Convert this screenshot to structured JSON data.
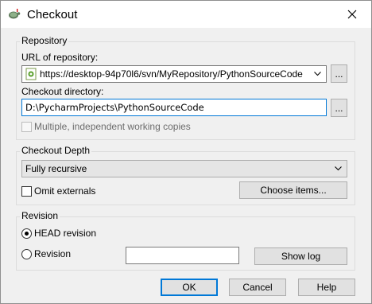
{
  "window": {
    "title": "Checkout"
  },
  "repository": {
    "legend": "Repository",
    "url_label": "URL of repository:",
    "url_value": "https://desktop-94p70l6/svn/MyRepository/PythonSourceCode",
    "url_browse": "...",
    "dir_label": "Checkout directory:",
    "dir_value": "D:\\PycharmProjects\\PythonSourceCode",
    "dir_browse": "...",
    "multiple_label": "Multiple, independent working copies"
  },
  "depth": {
    "legend": "Checkout Depth",
    "selected": "Fully recursive",
    "omit_label": "Omit externals",
    "choose_items": "Choose items..."
  },
  "revision": {
    "legend": "Revision",
    "head_label": "HEAD revision",
    "rev_label": "Revision",
    "rev_value": "",
    "show_log": "Show log"
  },
  "buttons": {
    "ok": "OK",
    "cancel": "Cancel",
    "help": "Help"
  },
  "colors": {
    "accent": "#0078d7",
    "dialog_bg": "#f0f0f0"
  }
}
